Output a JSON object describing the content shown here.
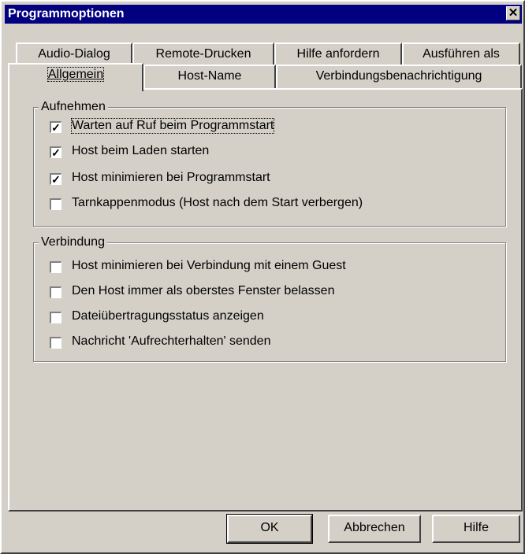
{
  "window": {
    "title": "Programmoptionen",
    "close_glyph": "✕"
  },
  "tabs_row1": [
    {
      "label": "Audio-Dialog"
    },
    {
      "label": "Remote-Drucken"
    },
    {
      "label": "Hilfe anfordern"
    },
    {
      "label": "Ausführen als"
    }
  ],
  "tabs_row2": [
    {
      "label": "Allgemein"
    },
    {
      "label": "Host-Name"
    },
    {
      "label": "Verbindungsbenachrichtigung"
    }
  ],
  "groups": {
    "aufnehmen": {
      "label": "Aufnehmen",
      "items": [
        {
          "label": "Warten auf Ruf beim Programmstart",
          "checked": "✓"
        },
        {
          "label": "Host beim Laden starten",
          "checked": "✓"
        },
        {
          "label": "Host minimieren bei Programmstart",
          "checked": "✓"
        },
        {
          "label": "Tarnkappenmodus (Host nach dem Start verbergen)",
          "checked": ""
        }
      ]
    },
    "verbindung": {
      "label": "Verbindung",
      "items": [
        {
          "label": "Host minimieren bei Verbindung mit einem Guest",
          "checked": ""
        },
        {
          "label": "Den Host immer als oberstes Fenster belassen",
          "checked": ""
        },
        {
          "label": "Dateiübertragungsstatus anzeigen",
          "checked": ""
        },
        {
          "label": "Nachricht 'Aufrechterhalten' senden",
          "checked": ""
        }
      ]
    }
  },
  "buttons": {
    "ok": "OK",
    "cancel": "Abbrechen",
    "help": "Hilfe"
  }
}
